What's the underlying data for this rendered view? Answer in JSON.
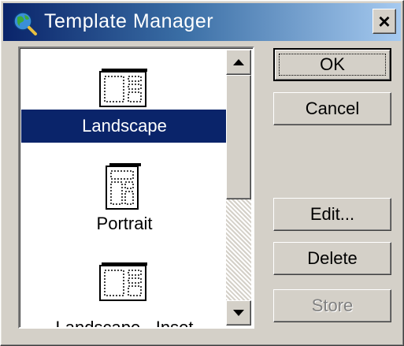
{
  "window": {
    "title": "Template Manager",
    "close_label": "×"
  },
  "list": {
    "items": [
      {
        "label": "Landscape",
        "icon": "landscape-template-icon",
        "selected": true
      },
      {
        "label": "Portrait",
        "icon": "portrait-template-icon",
        "selected": false
      },
      {
        "label": "Landscape - Inset",
        "icon": "landscape-inset-template-icon",
        "selected": false
      }
    ]
  },
  "buttons": {
    "ok": "OK",
    "cancel": "Cancel",
    "edit": "Edit...",
    "delete": "Delete",
    "store": "Store"
  },
  "colors": {
    "title_bar_start": "#0a246a",
    "title_bar_end": "#a6caf0",
    "selection": "#0a246a",
    "face": "#d4d0c8"
  }
}
